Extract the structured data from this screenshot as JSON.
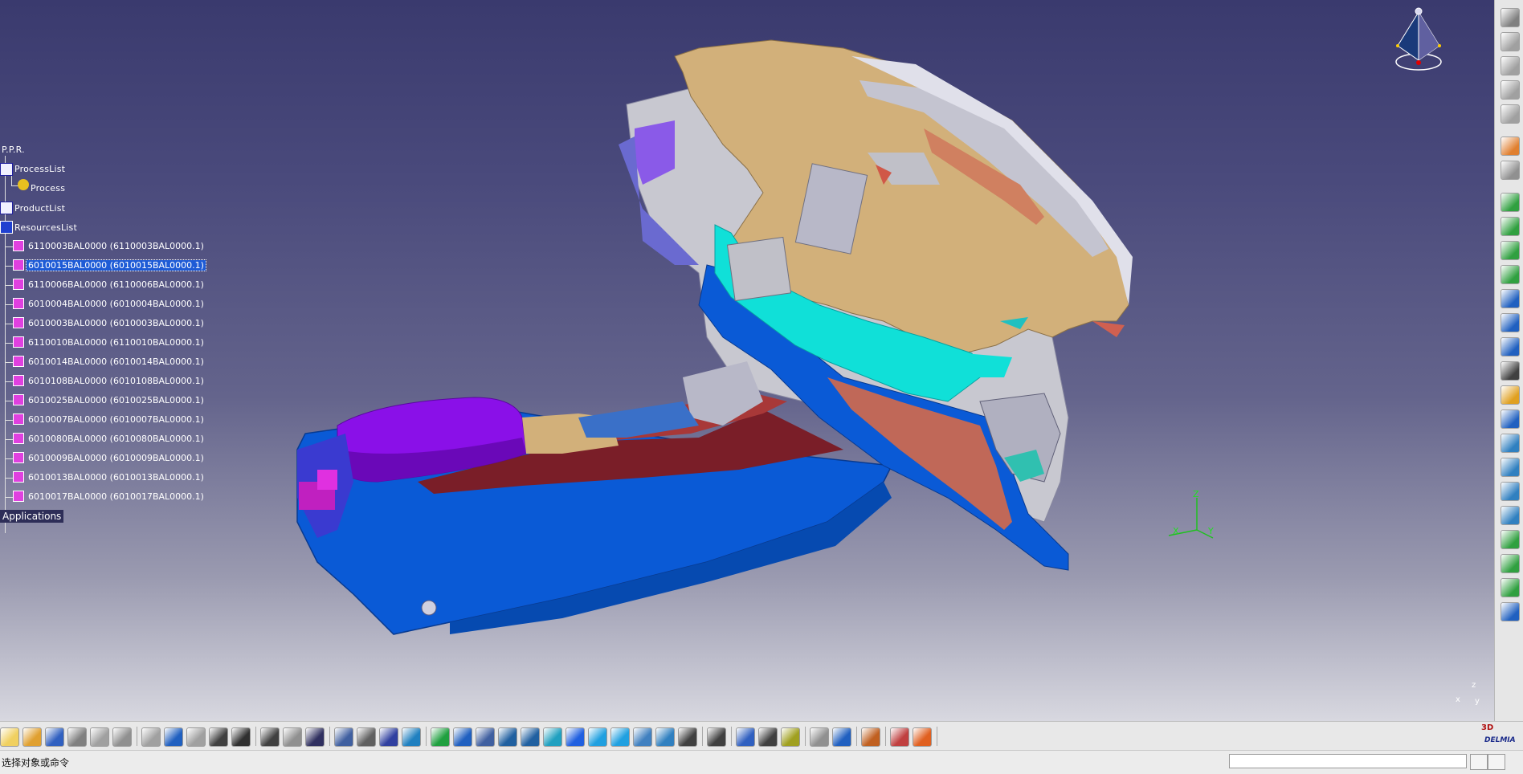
{
  "tree": {
    "root": "P.P.R.",
    "process_list": "ProcessList",
    "process": "Process",
    "product_list": "ProductList",
    "resources_list": "ResourcesList",
    "resources": [
      {
        "label": "6110003BAL0000 (6110003BAL0000.1)",
        "selected": false
      },
      {
        "label": "6010015BAL0000 (6010015BAL0000.1)",
        "selected": true
      },
      {
        "label": "6110006BAL0000 (6110006BAL0000.1)",
        "selected": false
      },
      {
        "label": "6010004BAL0000 (6010004BAL0000.1)",
        "selected": false
      },
      {
        "label": "6010003BAL0000 (6010003BAL0000.1)",
        "selected": false
      },
      {
        "label": "6110010BAL0000 (6110010BAL0000.1)",
        "selected": false
      },
      {
        "label": "6010014BAL0000 (6010014BAL0000.1)",
        "selected": false
      },
      {
        "label": "6010108BAL0000 (6010108BAL0000.1)",
        "selected": false
      },
      {
        "label": "6010025BAL0000 (6010025BAL0000.1)",
        "selected": false
      },
      {
        "label": "6010007BAL0000 (6010007BAL0000.1)",
        "selected": false
      },
      {
        "label": "6010080BAL0000 (6010080BAL0000.1)",
        "selected": false
      },
      {
        "label": "6010009BAL0000 (6010009BAL0000.1)",
        "selected": false
      },
      {
        "label": "6010013BAL0000 (6010013BAL0000.1)",
        "selected": false
      },
      {
        "label": "6010017BAL0000 (6010017BAL0000.1)",
        "selected": false
      }
    ],
    "applications": "Applications"
  },
  "axes": {
    "x": "X",
    "y": "Y",
    "z": "Z"
  },
  "mini_axes": {
    "y": "y",
    "z": "z",
    "x": "x"
  },
  "status": {
    "prompt": "选择对象或命令",
    "command_value": ""
  },
  "brand": {
    "logo_text": "DELMIA",
    "logo_number": "3D"
  },
  "colors": {
    "background_top": "#3a3a6e",
    "background_bottom": "#d8d8e0",
    "dashboard": "#d2b07a",
    "console_blue": "#0a5ad6",
    "armrest": "#8a10e8",
    "trim_cyan": "#10e0d8",
    "frame_grey": "#c8c8d0",
    "selection": "#1e5bd6"
  },
  "toolbar_icons": [
    "new-icon",
    "open-icon",
    "save-icon",
    "print-icon",
    "cut-icon",
    "copy-icon",
    "paste-icon",
    "undo-icon",
    "redo-icon",
    "whats-this-icon",
    "formula-icon",
    "comment-icon",
    "knowledge-icon",
    "table-icon",
    "tree-icon",
    "catalog-icon",
    "spec-icon",
    "fly-mode-icon",
    "fit-all-icon",
    "pan-icon",
    "rotate-icon",
    "zoom-in-icon",
    "zoom-out-icon",
    "normal-view-icon",
    "multi-view-icon",
    "iso-view-icon",
    "render-style-icon",
    "hide-show-icon",
    "swap-icon",
    "capture-icon",
    "measure-icon",
    "clash-icon",
    "distance-icon",
    "analysis-icon",
    "simulation-icon",
    "sectioning-icon",
    "player-icon",
    "filter-icon",
    "grid-icon"
  ],
  "right_toolbar_icons": [
    "compass-icon",
    "product-icon",
    "manufacturing-icon",
    "process-icon",
    "resource-icon",
    "select-icon",
    "snap-icon",
    "gear-icon",
    "gear-icon-2",
    "gear-icon-3",
    "arrow-icon",
    "insert-icon",
    "move-icon",
    "list-icon",
    "text-icon",
    "tree-icon",
    "manager-icon",
    "robot-icon",
    "tool-icon",
    "simulation-icon",
    "link-icon",
    "mfg-icon",
    "assign-icon",
    "export-icon",
    "compass-reset-icon"
  ]
}
